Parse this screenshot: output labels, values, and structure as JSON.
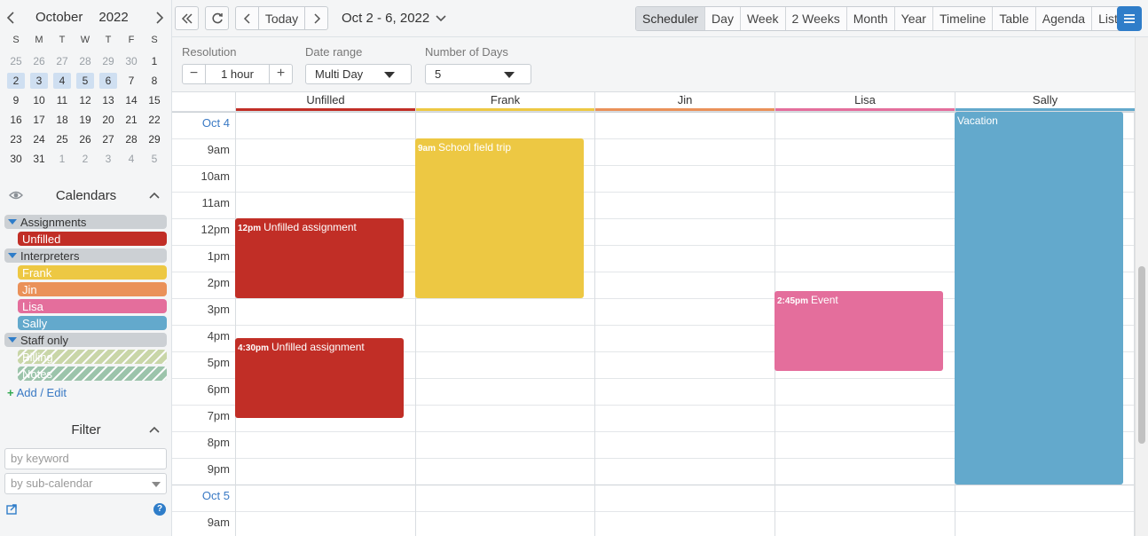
{
  "mini_calendar": {
    "month": "October",
    "year": "2022",
    "dow": [
      "S",
      "M",
      "T",
      "W",
      "T",
      "F",
      "S"
    ],
    "weeks": [
      [
        "25",
        "26",
        "27",
        "28",
        "29",
        "30",
        "1"
      ],
      [
        "2",
        "3",
        "4",
        "5",
        "6",
        "7",
        "8"
      ],
      [
        "9",
        "10",
        "11",
        "12",
        "13",
        "14",
        "15"
      ],
      [
        "16",
        "17",
        "18",
        "19",
        "20",
        "21",
        "22"
      ],
      [
        "23",
        "24",
        "25",
        "26",
        "27",
        "28",
        "29"
      ],
      [
        "30",
        "31",
        "1",
        "2",
        "3",
        "4",
        "5"
      ]
    ]
  },
  "calendars": {
    "title": "Calendars",
    "groups": [
      {
        "label": "Assignments",
        "items": [
          {
            "label": "Unfilled",
            "color": "#c12e26"
          }
        ]
      },
      {
        "label": "Interpreters",
        "items": [
          {
            "label": "Frank",
            "color": "#edc843"
          },
          {
            "label": "Jin",
            "color": "#ea9159"
          },
          {
            "label": "Lisa",
            "color": "#e46e9c"
          },
          {
            "label": "Sally",
            "color": "#63a9cc"
          }
        ]
      },
      {
        "label": "Staff only",
        "items": [
          {
            "label": "Billing",
            "color": "#c9d6a8"
          },
          {
            "label": "Notes",
            "color": "#9cc4ab"
          }
        ]
      }
    ],
    "add_edit": "Add / Edit"
  },
  "filter": {
    "title": "Filter",
    "keyword_placeholder": "by keyword",
    "subcal_placeholder": "by sub-calendar"
  },
  "toolbar": {
    "today": "Today",
    "date_range": "Oct 2 - 6, 2022",
    "views": [
      "Scheduler",
      "Day",
      "Week",
      "2 Weeks",
      "Month",
      "Year",
      "Timeline",
      "Table",
      "Agenda",
      "List"
    ],
    "active_view": "Scheduler"
  },
  "options": {
    "resolution_label": "Resolution",
    "resolution_value": "1 hour",
    "date_range_label": "Date range",
    "date_range_value": "Multi Day",
    "days_label": "Number of Days",
    "days_value": "5"
  },
  "scheduler": {
    "columns": [
      {
        "label": "Unfilled",
        "color": "#c12e26"
      },
      {
        "label": "Frank",
        "color": "#edc843"
      },
      {
        "label": "Jin",
        "color": "#ea9159"
      },
      {
        "label": "Lisa",
        "color": "#e46e9c"
      },
      {
        "label": "Sally",
        "color": "#63a9cc"
      }
    ],
    "rows": [
      {
        "label": "Oct 4",
        "day": true
      },
      {
        "label": "9am"
      },
      {
        "label": "10am"
      },
      {
        "label": "11am"
      },
      {
        "label": "12pm"
      },
      {
        "label": "1pm"
      },
      {
        "label": "2pm"
      },
      {
        "label": "3pm"
      },
      {
        "label": "4pm"
      },
      {
        "label": "5pm"
      },
      {
        "label": "6pm"
      },
      {
        "label": "7pm"
      },
      {
        "label": "8pm"
      },
      {
        "label": "9pm"
      },
      {
        "label": "Oct 5",
        "day": true
      },
      {
        "label": "9am"
      }
    ],
    "events": [
      {
        "time": "9am",
        "title": "School field trip",
        "color": "#edc843"
      },
      {
        "time": "12pm",
        "title": "Unfilled assignment",
        "color": "#c12e26"
      },
      {
        "time": "2:45pm",
        "title": "Event",
        "color": "#e46e9c"
      },
      {
        "time": "4:30pm",
        "title": "Unfilled assignment",
        "color": "#c12e26"
      },
      {
        "time": "",
        "title": "Vacation",
        "color": "#63a9cc"
      }
    ]
  }
}
